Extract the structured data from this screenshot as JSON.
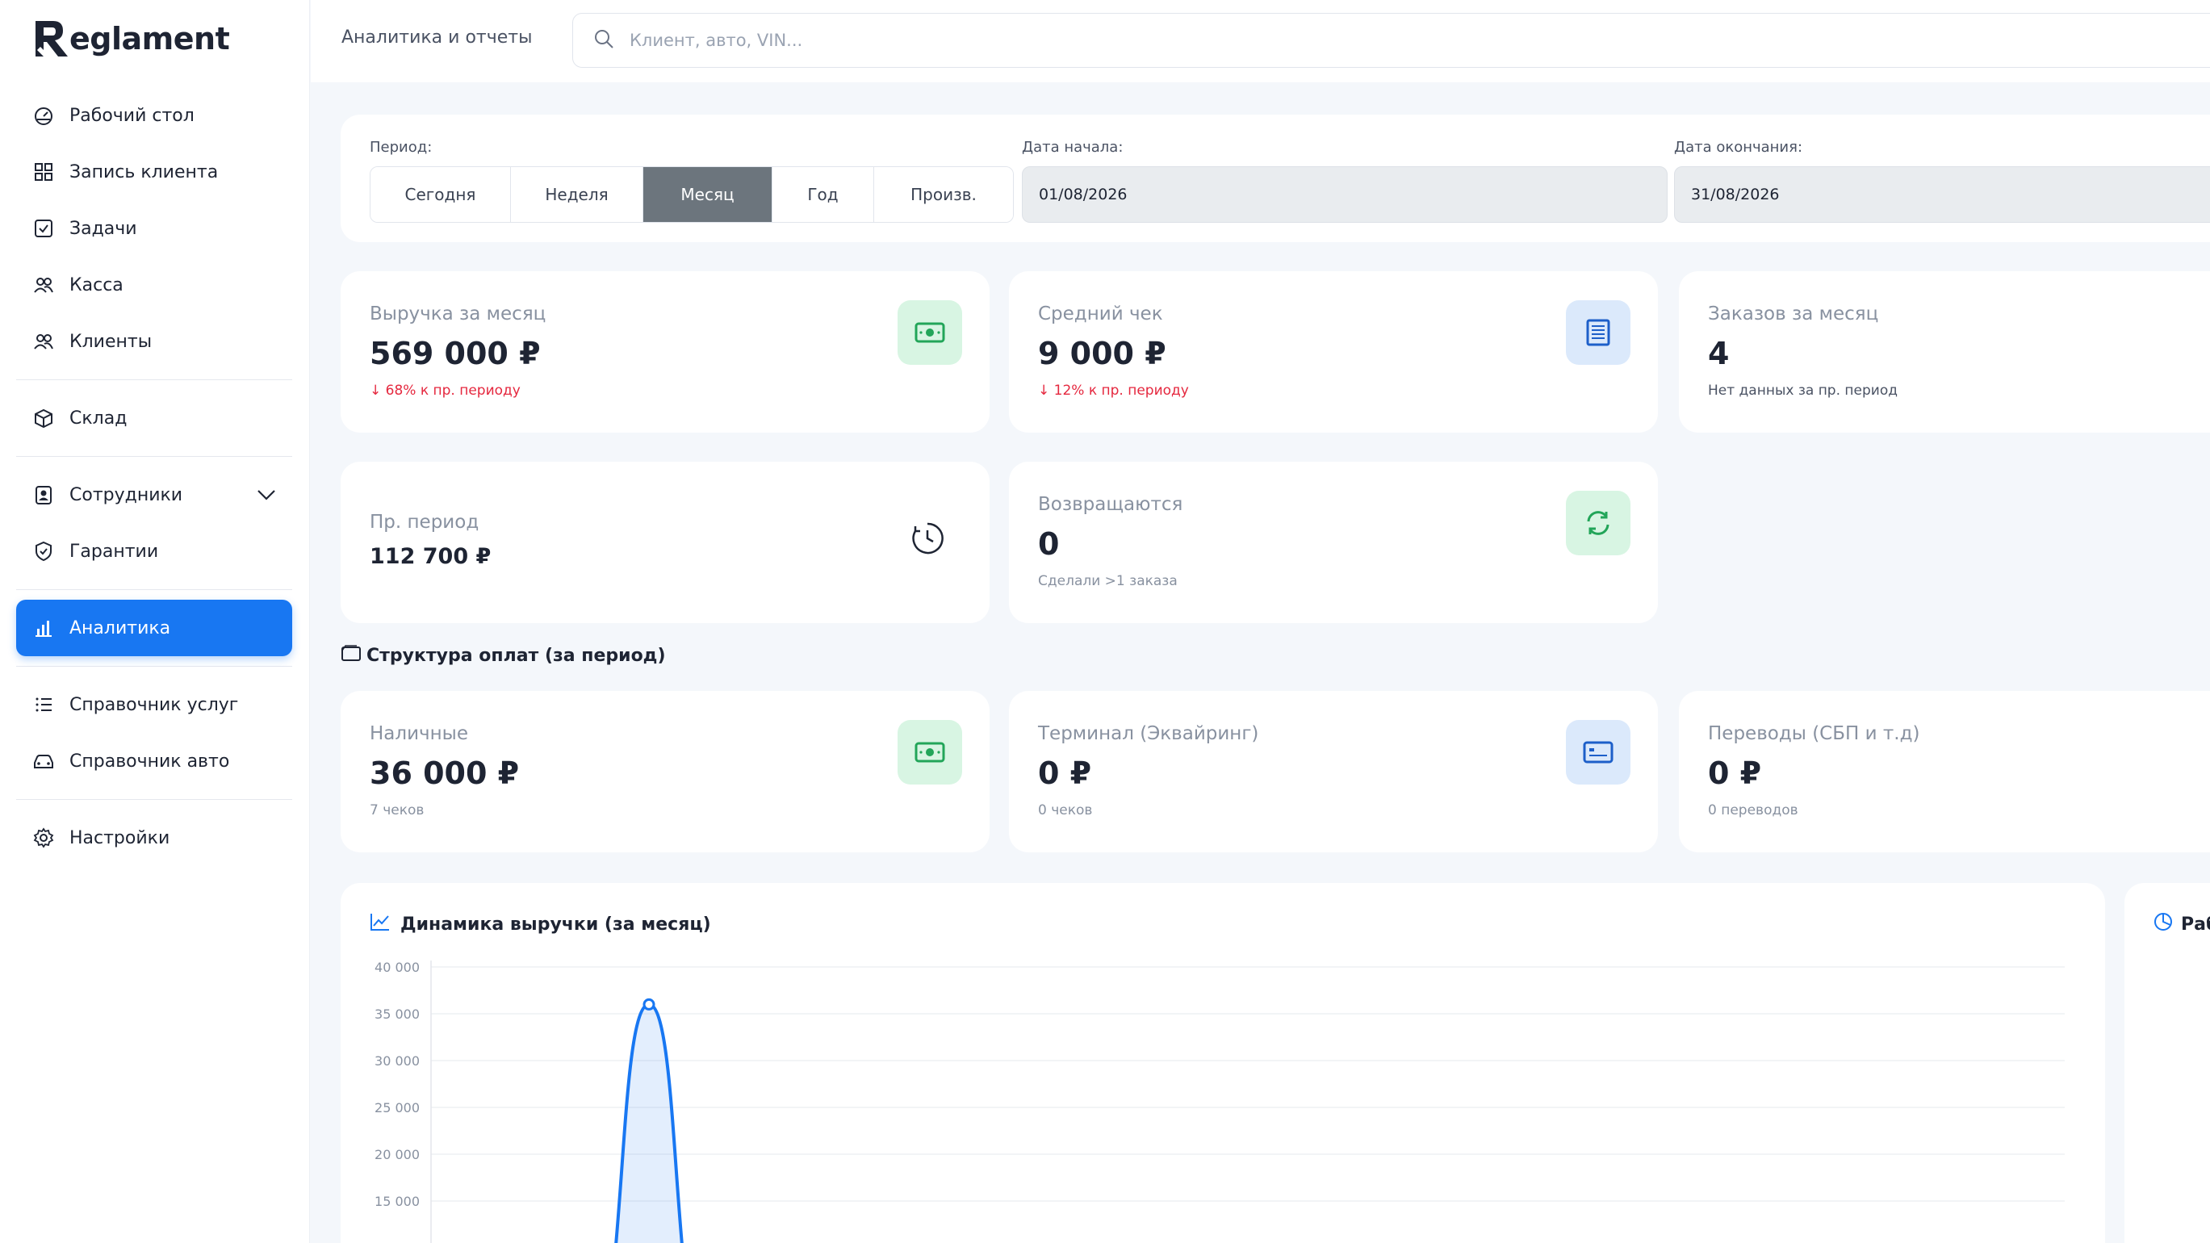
{
  "app": {
    "brand": "eglament",
    "brand_letter": "R"
  },
  "sidebar": {
    "items": [
      {
        "label": "Рабочий стол",
        "icon": "dashboard-icon"
      },
      {
        "label": "Запись клиента",
        "icon": "grid-icon"
      },
      {
        "label": "Задачи",
        "icon": "checkbox-icon"
      },
      {
        "label": "Касса",
        "icon": "users-icon"
      },
      {
        "label": "Клиенты",
        "icon": "users-icon"
      },
      {
        "label": "Склад",
        "icon": "box-icon"
      },
      {
        "label": "Сотрудники",
        "icon": "badge-icon"
      },
      {
        "label": "Гарантии",
        "icon": "shield-icon"
      },
      {
        "label": "Аналитика",
        "icon": "bar-chart-icon",
        "active": true
      },
      {
        "label": "Справочник услуг",
        "icon": "list-icon"
      },
      {
        "label": "Справочник авто",
        "icon": "car-icon"
      },
      {
        "label": "Настройки",
        "icon": "gear-icon"
      }
    ]
  },
  "header": {
    "title": "Аналитика и отчеты",
    "search_placeholder": "Клиент, авто, VIN..."
  },
  "period": {
    "label": "Период:",
    "options": [
      "Сегодня",
      "Неделя",
      "Месяц",
      "Год",
      "Произв."
    ],
    "selected": "Месяц",
    "start_label": "Дата начала:",
    "start_value": "01/08/2026",
    "end_label": "Дата окончания:",
    "end_value": "31/08/2026"
  },
  "stats": {
    "revenue": {
      "label": "Выручка за месяц",
      "value": "569 000 ₽",
      "delta": "↓ 68% к пр. периоду"
    },
    "avg_check": {
      "label": "Средний чек",
      "value": "9 000 ₽",
      "delta": "↓ 12% к пр. периоду"
    },
    "orders": {
      "label": "Заказов за месяц",
      "value": "4",
      "note": "Нет данных за пр. период"
    },
    "prev_period": {
      "label": "Пр. период",
      "value": "112 700 ₽"
    },
    "returning": {
      "label": "Возвращаются",
      "value": "0",
      "note": "Сделали >1 заказа"
    }
  },
  "payments": {
    "title": "Структура оплат (за период)",
    "cash": {
      "label": "Наличные",
      "value": "36 000 ₽",
      "note": "7 чеков"
    },
    "terminal": {
      "label": "Терминал (Эквайринг)",
      "value": "0 ₽",
      "note": "0 чеков"
    },
    "transfers": {
      "label": "Переводы (СБП и т.д)",
      "value": "0 ₽",
      "note": "0 переводов"
    }
  },
  "chart": {
    "title": "Динамика выручки (за месяц)",
    "side_title": "Раб",
    "accent": "#1877f2"
  },
  "chart_data": {
    "type": "area",
    "title": "Динамика выручки (за месяц)",
    "y_ticks": [
      "40 000",
      "35 000",
      "30 000",
      "25 000",
      "20 000",
      "15 000"
    ],
    "ylim": [
      0,
      40000
    ],
    "peak_value": 36000,
    "grid": true
  }
}
